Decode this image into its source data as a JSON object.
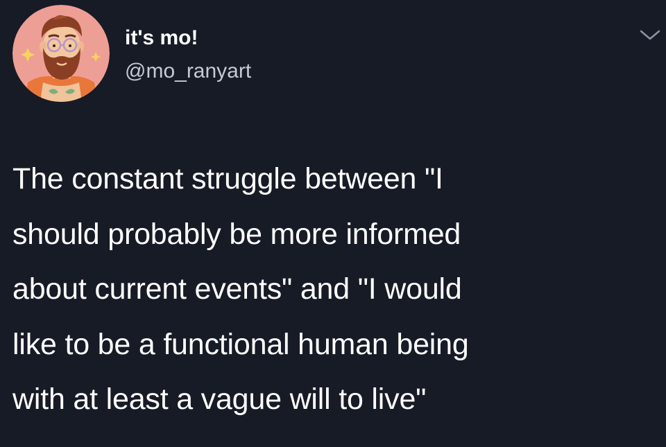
{
  "author": {
    "display_name": "it's mo!",
    "handle": "@mo_ranyart",
    "avatar_icon": "cartoon-bearded-man-avatar",
    "avatar_bg": "#ee9f95"
  },
  "menu": {
    "icon": "chevron-down-icon"
  },
  "tweet": {
    "lines": [
      "The constant struggle between \"I",
      "should probably be more informed",
      "about current events\" and \"I would",
      "like to be a functional human being",
      "with at least a vague will to live\""
    ]
  },
  "colors": {
    "background": "#171b26",
    "text": "#ffffff",
    "handle": "#c5cbd3",
    "chevron": "#8a94a3"
  }
}
